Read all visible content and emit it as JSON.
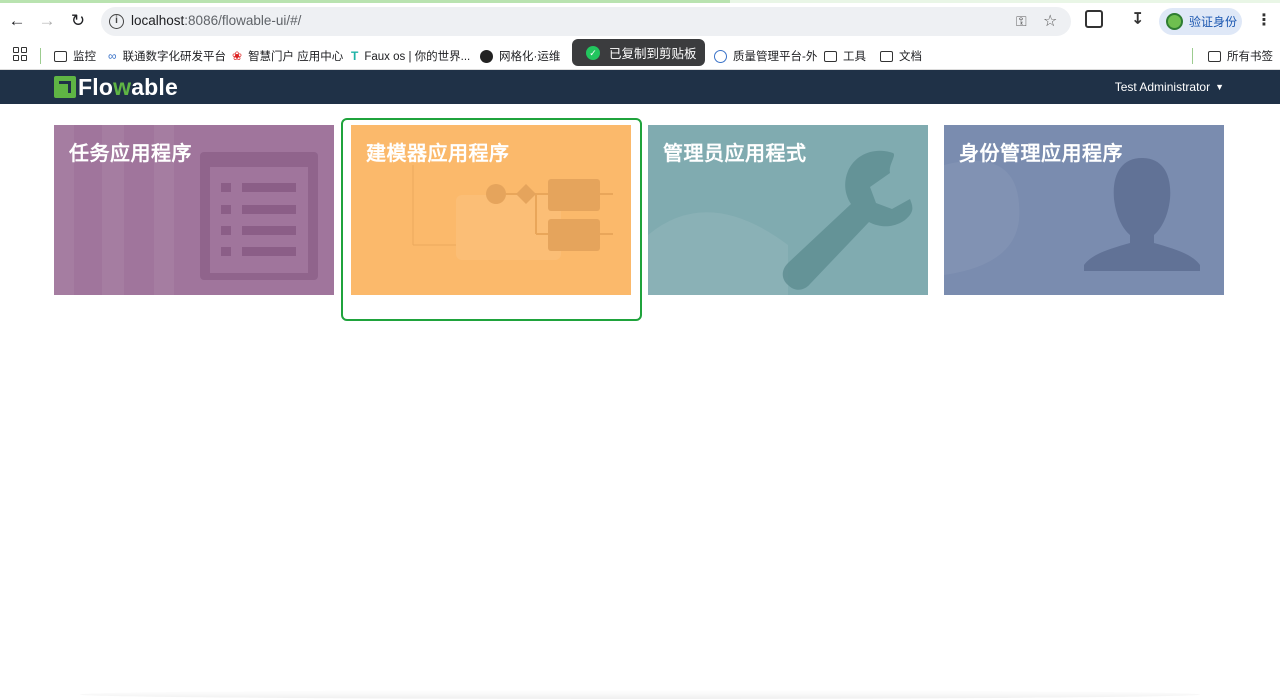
{
  "browser": {
    "url_host": "localhost",
    "url_path": ":8086/flowable-ui/#/",
    "verify_label": "验证身份",
    "toast_text": "已复制到剪贴板"
  },
  "bookmarks": {
    "items": [
      {
        "label": "监控",
        "icon": "folder-icon"
      },
      {
        "label": "联通数字化研发平台",
        "icon": "link-icon"
      },
      {
        "label": "智慧门户 应用中心",
        "icon": "huawei-icon"
      },
      {
        "label": "Faux os | 你的世界...",
        "icon": "t-icon"
      },
      {
        "label": "网格化·运维",
        "icon": "globe-icon"
      },
      {
        "label": "质量管理平台-外",
        "icon": "chart-icon"
      },
      {
        "label": "工具",
        "icon": "folder-icon"
      },
      {
        "label": "文档",
        "icon": "folder-icon"
      }
    ],
    "all_bookmarks": "所有书签"
  },
  "navbar": {
    "logo_part1": "Flo",
    "logo_part2": "w",
    "logo_part3": "able",
    "user": "Test Administrator"
  },
  "tiles": [
    {
      "title": "任务应用程序",
      "color": "#a0759c"
    },
    {
      "title": "建模器应用程序",
      "color": "#fbb96b"
    },
    {
      "title": "管理员应用程式",
      "color": "#80abb0"
    },
    {
      "title": "身份管理应用程序",
      "color": "#7a8caf"
    }
  ]
}
